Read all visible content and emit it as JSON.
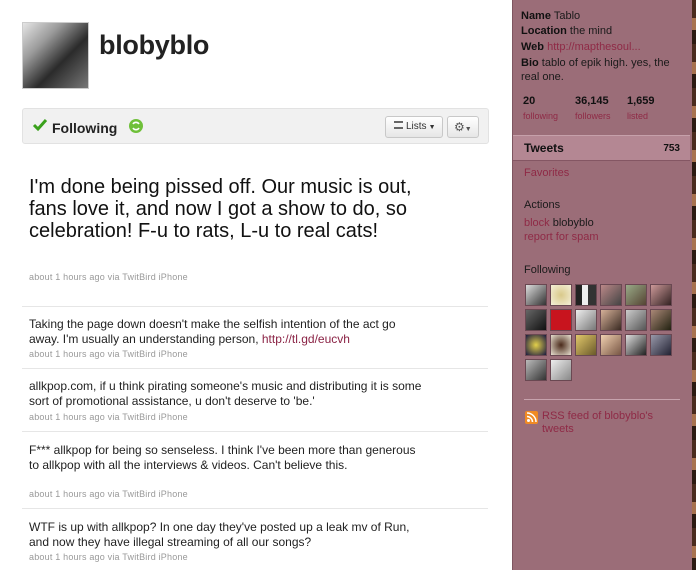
{
  "profile": {
    "screen_name": "blobyblo",
    "avatar": "profile-photo-guitar"
  },
  "follow_bar": {
    "following_label": "Following",
    "check_icon": "check-icon",
    "refresh_icon": "refresh-icon",
    "lists_label": "Lists",
    "gear_icon": "gear-icon"
  },
  "featured_tweet": {
    "text": "I'm done being pissed off. Our music is out, fans love it, and now I got a show to do, so celebration! F-u to rats, L-u to real cats!",
    "meta": "about 1 hours ago via TwitBird iPhone"
  },
  "tweets": [
    {
      "text_before_link": "Taking the page down doesn't make the selfish intention of the act go away. I'm usually an understanding person, ",
      "link": "http://tl.gd/eucvh",
      "meta": "about 1 hours ago via TwitBird iPhone"
    },
    {
      "text": "allkpop.com, if u think pirating someone's music and distributing it is some sort of promotional assistance, u don't deserve to 'be.'",
      "meta": "about 1 hours ago via TwitBird iPhone"
    },
    {
      "text": "F*** allkpop for being so senseless. I think I've been more than generous to allkpop with all the interviews & videos. Can't believe this.",
      "meta": "about 1 hours ago via TwitBird iPhone"
    },
    {
      "text": "WTF is up with allkpop? In one day they've posted up a leak mv of Run, and now they have illegal streaming of all our songs?",
      "meta": "about 1 hours ago via TwitBird iPhone"
    }
  ],
  "sidebar": {
    "name_label": "Name",
    "name_value": "Tablo",
    "location_label": "Location",
    "location_value": "the mind",
    "web_label": "Web",
    "web_value": "http://mapthesoul...",
    "bio_label": "Bio",
    "bio_value": "tablo of epik high. yes, the real one.",
    "stats": [
      {
        "num": "20",
        "label": "following"
      },
      {
        "num": "36,145",
        "label": "followers"
      },
      {
        "num": "1,659",
        "label": "listed"
      }
    ],
    "tweets_label": "Tweets",
    "tweets_count": "753",
    "favorites_label": "Favorites",
    "actions_title": "Actions",
    "block_label": "block",
    "block_name": "blobyblo",
    "report_label": "report for spam",
    "following_title": "Following",
    "rss_label": "RSS feed of blobyblo's tweets"
  },
  "colors": {
    "sidebar_bg": "#9b6d78",
    "link": "#8f2a46",
    "follow_green": "#3aa11c"
  }
}
